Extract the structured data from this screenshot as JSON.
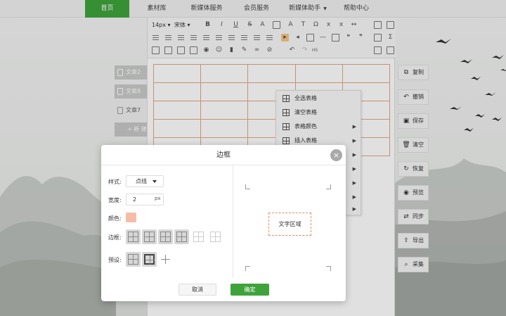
{
  "nav": {
    "items": [
      {
        "label": "首页",
        "active": true
      },
      {
        "label": "素材库"
      },
      {
        "label": "新媒体服务"
      },
      {
        "label": "会员服务"
      },
      {
        "label": "新媒体助手",
        "dropdown": true
      },
      {
        "label": "帮助中心"
      }
    ]
  },
  "docs": {
    "items": [
      "文章2",
      "文章8",
      "文章7"
    ],
    "new_label": "+ 新 建"
  },
  "toolbar": {
    "font_size": "14px",
    "font_family": "宋体",
    "row3_text": "H5"
  },
  "context_menu": {
    "items": [
      {
        "label": "全选表格"
      },
      {
        "label": "清空表格"
      },
      {
        "label": "表格颜色",
        "submenu": true
      },
      {
        "label": "插入表格",
        "submenu": true
      }
    ]
  },
  "side_actions": [
    "复制",
    "撤销",
    "保存",
    "清空",
    "恢复",
    "预览",
    "同步",
    "导出",
    "采集"
  ],
  "dialog": {
    "title": "边框",
    "close_icon": "×",
    "style_label": "样式:",
    "style_value": "点线",
    "width_label": "宽度:",
    "width_value": "2",
    "width_unit": "px",
    "color_label": "颜色:",
    "color_value": "#f5bda8",
    "border_label": "边框:",
    "preset_label": "预设:",
    "preview_text": "文字区域",
    "cancel_label": "取消",
    "ok_label": "确定"
  },
  "colors": {
    "primary": "#3fa33c",
    "table_border": "#e3a583"
  }
}
